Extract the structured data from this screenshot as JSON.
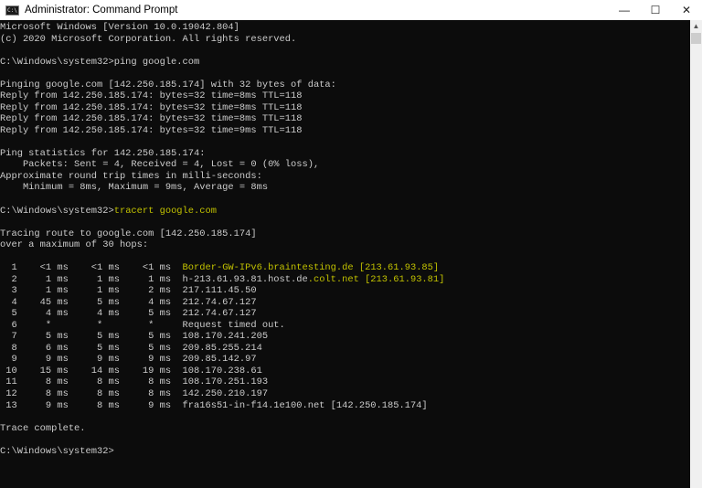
{
  "window": {
    "title": "Administrator: Command Prompt",
    "controls": {
      "minimize": "—",
      "maximize": "☐",
      "close": "✕"
    },
    "scroll_up": "▲"
  },
  "colors": {
    "background": "#0c0c0c",
    "text": "#cccccc",
    "highlight": "#c1c100"
  },
  "console": {
    "lines": [
      [
        {
          "t": "Microsoft Windows [Version 10.0.19042.804]"
        }
      ],
      [
        {
          "t": "(c) 2020 Microsoft Corporation. All rights reserved."
        }
      ],
      [],
      [
        {
          "t": "C:\\Windows\\system32>ping google.com"
        }
      ],
      [],
      [
        {
          "t": "Pinging google.com [142.250.185.174] with 32 bytes of data:"
        }
      ],
      [
        {
          "t": "Reply from 142.250.185.174: bytes=32 time=8ms TTL=118"
        }
      ],
      [
        {
          "t": "Reply from 142.250.185.174: bytes=32 time=8ms TTL=118"
        }
      ],
      [
        {
          "t": "Reply from 142.250.185.174: bytes=32 time=8ms TTL=118"
        }
      ],
      [
        {
          "t": "Reply from 142.250.185.174: bytes=32 time=9ms TTL=118"
        }
      ],
      [],
      [
        {
          "t": "Ping statistics for 142.250.185.174:"
        }
      ],
      [
        {
          "t": "    Packets: Sent = 4, Received = 4, Lost = 0 (0% loss),"
        }
      ],
      [
        {
          "t": "Approximate round trip times in milli-seconds:"
        }
      ],
      [
        {
          "t": "    Minimum = 8ms, Maximum = 9ms, Average = 8ms"
        }
      ],
      [],
      [
        {
          "t": "C:\\Windows\\system32>"
        },
        {
          "t": "tracert google.com",
          "hl": true
        }
      ],
      [],
      [
        {
          "t": "Tracing route to google.com [142.250.185.174]"
        }
      ],
      [
        {
          "t": "over a maximum of 30 hops:"
        }
      ],
      [],
      [
        {
          "t": "  1    <1 ms    <1 ms    <1 ms  "
        },
        {
          "t": "Border-GW-IPv6.braintesting.de [213.61.93.85]",
          "hl": true
        }
      ],
      [
        {
          "t": "  2     1 ms     1 ms     1 ms  h-213.61.93.81.host.de"
        },
        {
          "t": ".colt.net [213.61.93.81]",
          "hl": true
        }
      ],
      [
        {
          "t": "  3     1 ms     1 ms     2 ms  217.111.45.50"
        }
      ],
      [
        {
          "t": "  4    45 ms     5 ms     4 ms  212.74.67.127"
        }
      ],
      [
        {
          "t": "  5     4 ms     4 ms     5 ms  212.74.67.127"
        }
      ],
      [
        {
          "t": "  6     *        *        *     Request timed out."
        }
      ],
      [
        {
          "t": "  7     5 ms     5 ms     5 ms  108.170.241.205"
        }
      ],
      [
        {
          "t": "  8     6 ms     5 ms     5 ms  209.85.255.214"
        }
      ],
      [
        {
          "t": "  9     9 ms     9 ms     9 ms  209.85.142.97"
        }
      ],
      [
        {
          "t": " 10    15 ms    14 ms    19 ms  108.170.238.61"
        }
      ],
      [
        {
          "t": " 11     8 ms     8 ms     8 ms  108.170.251.193"
        }
      ],
      [
        {
          "t": " 12     8 ms     8 ms     8 ms  142.250.210.197"
        }
      ],
      [
        {
          "t": " 13     9 ms     8 ms     9 ms  fra16s51-in-f14.1e100.net [142.250.185.174]"
        }
      ],
      [],
      [
        {
          "t": "Trace complete."
        }
      ],
      [],
      [
        {
          "t": "C:\\Windows\\system32>"
        }
      ]
    ]
  }
}
